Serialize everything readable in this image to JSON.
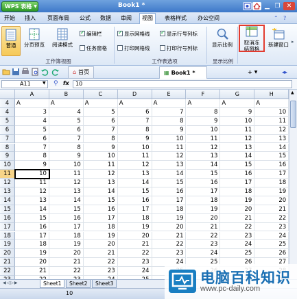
{
  "app": {
    "button_label": "WPS 表格",
    "window_title": "Book1 *"
  },
  "menu": [
    "开始",
    "插入",
    "页面布局",
    "公式",
    "数据",
    "审阅",
    "视图",
    "表格样式",
    "办公空间"
  ],
  "active_menu": "视图",
  "ribbon": {
    "normal": "普通",
    "page_break_preview": "分页预览",
    "reading_mode": "阅读模式",
    "edit_bar": "编辑栏",
    "task_pane": "任务窗格",
    "show_gridlines": "显示网格线",
    "print_gridlines": "打印网格线",
    "show_headings": "显示行号列标",
    "print_headings": "打印行号列标",
    "zoom": "显示比例",
    "unfreeze_line1": "取消冻",
    "unfreeze_line2": "结窗格",
    "new_window": "新建窗口",
    "group_workbook_view": "工作簿视图",
    "group_sheet_options": "工作表选项",
    "group_zoom": "显示比例"
  },
  "tabs": {
    "home": "首页",
    "book": "Book1 *"
  },
  "formula": {
    "name_box": "A11",
    "fx": "fx",
    "value": "10"
  },
  "columns": [
    "A",
    "B",
    "C",
    "D",
    "E",
    "F",
    "G",
    "H"
  ],
  "rows": [
    {
      "n": "4",
      "v": [
        "A",
        "A",
        "A",
        "A",
        "A",
        "A",
        "A",
        "A"
      ]
    },
    {
      "n": "4",
      "v": [
        "3",
        "4",
        "5",
        "6",
        "7",
        "8",
        "9",
        "10"
      ]
    },
    {
      "n": "5",
      "v": [
        "4",
        "5",
        "6",
        "7",
        "8",
        "9",
        "10",
        "11"
      ]
    },
    {
      "n": "6",
      "v": [
        "5",
        "6",
        "7",
        "8",
        "9",
        "10",
        "11",
        "12"
      ]
    },
    {
      "n": "7",
      "v": [
        "6",
        "7",
        "8",
        "9",
        "10",
        "11",
        "12",
        "13"
      ]
    },
    {
      "n": "8",
      "v": [
        "7",
        "8",
        "9",
        "10",
        "11",
        "12",
        "13",
        "14"
      ]
    },
    {
      "n": "9",
      "v": [
        "8",
        "9",
        "10",
        "11",
        "12",
        "13",
        "14",
        "15"
      ]
    },
    {
      "n": "10",
      "v": [
        "9",
        "10",
        "11",
        "12",
        "13",
        "14",
        "15",
        "16"
      ]
    },
    {
      "n": "11",
      "v": [
        "10",
        "11",
        "12",
        "13",
        "14",
        "15",
        "16",
        "17"
      ]
    },
    {
      "n": "12",
      "v": [
        "11",
        "12",
        "13",
        "14",
        "15",
        "16",
        "17",
        "18"
      ]
    },
    {
      "n": "13",
      "v": [
        "12",
        "13",
        "14",
        "15",
        "16",
        "17",
        "18",
        "19"
      ]
    },
    {
      "n": "14",
      "v": [
        "13",
        "14",
        "15",
        "16",
        "17",
        "18",
        "19",
        "20"
      ]
    },
    {
      "n": "15",
      "v": [
        "14",
        "15",
        "16",
        "17",
        "18",
        "19",
        "20",
        "21"
      ]
    },
    {
      "n": "16",
      "v": [
        "15",
        "16",
        "17",
        "18",
        "19",
        "20",
        "21",
        "22"
      ]
    },
    {
      "n": "17",
      "v": [
        "16",
        "17",
        "18",
        "19",
        "20",
        "21",
        "22",
        "23"
      ]
    },
    {
      "n": "18",
      "v": [
        "17",
        "18",
        "19",
        "20",
        "21",
        "22",
        "23",
        "24"
      ]
    },
    {
      "n": "19",
      "v": [
        "18",
        "19",
        "20",
        "21",
        "22",
        "23",
        "24",
        "25"
      ]
    },
    {
      "n": "20",
      "v": [
        "19",
        "20",
        "21",
        "22",
        "23",
        "24",
        "25",
        "26"
      ]
    },
    {
      "n": "21",
      "v": [
        "20",
        "21",
        "22",
        "23",
        "24",
        "25",
        "26",
        "27"
      ]
    },
    {
      "n": "22",
      "v": [
        "21",
        "22",
        "23",
        "24",
        "25",
        "26",
        "27",
        "28"
      ]
    },
    {
      "n": "23",
      "v": [
        "22",
        "23",
        "24",
        "25",
        "26",
        "27",
        "28",
        "29"
      ]
    }
  ],
  "selected_row": "11",
  "sheets": [
    "Sheet1",
    "Sheet2",
    "Sheet3"
  ],
  "active_sheet": "Sheet1",
  "status": {
    "value": "10"
  },
  "watermark": {
    "title": "电脑百科知识",
    "url": "www.pc-daily.com"
  },
  "colors": {
    "highlight": "#e23a2e",
    "selected_row": "#f7d488",
    "brand": "#1a6fb3"
  }
}
